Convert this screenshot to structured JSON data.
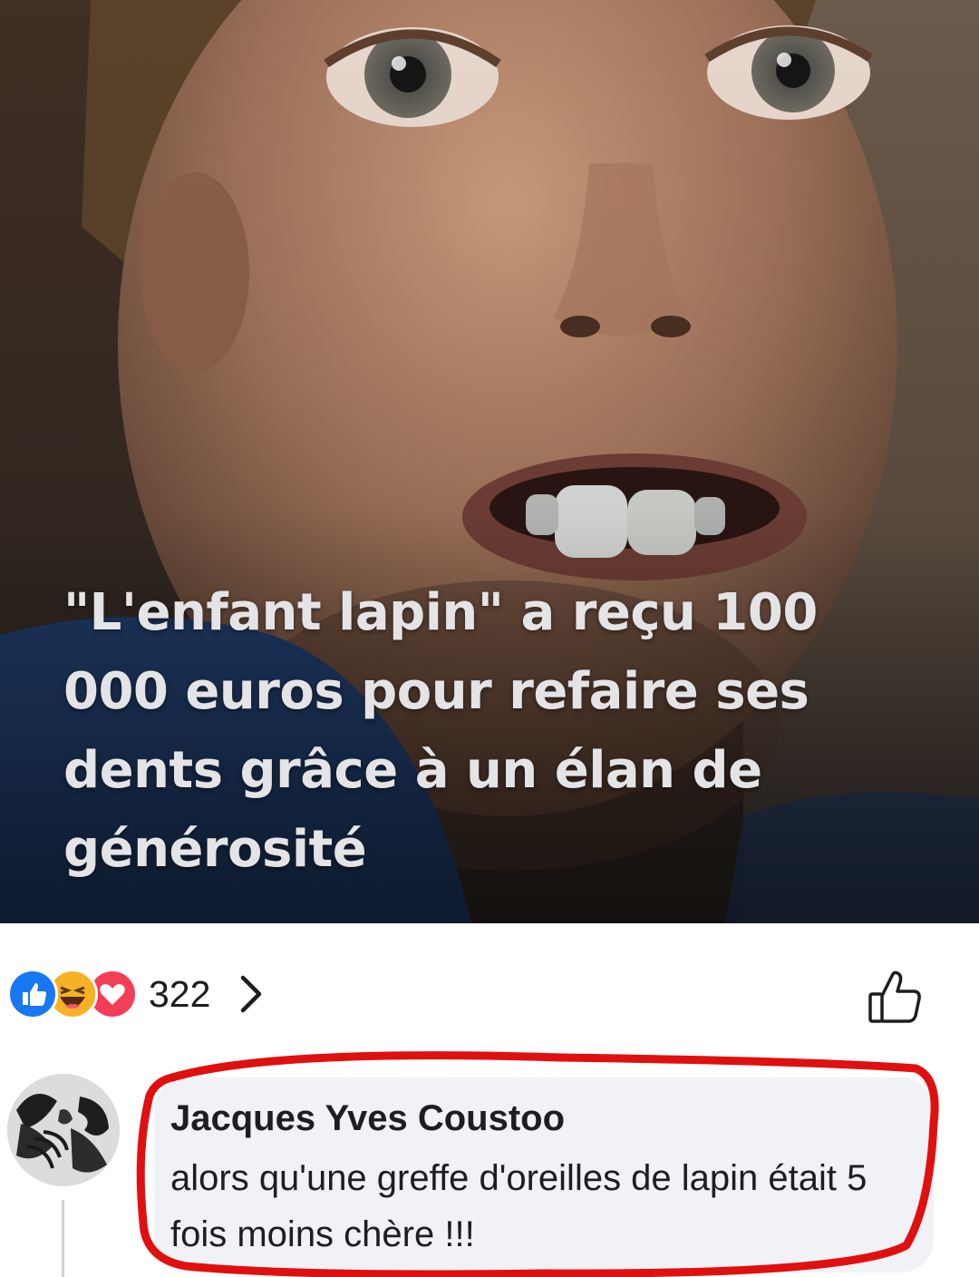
{
  "post": {
    "headline": "\"L'enfant lapin\" a reçu 100 000 euros pour refaire ses dents grâce à un élan de générosité"
  },
  "reactions": {
    "icons": [
      "like-icon",
      "haha-icon",
      "love-icon"
    ],
    "count": "322",
    "like_button_icon": "thumbs-up-outline-icon"
  },
  "comment": {
    "author": "Jacques Yves Coustoo",
    "text": "alors qu'une greffe d'oreilles de lapin était 5 fois moins chère !!!",
    "highlight_color": "#e01010"
  },
  "colors": {
    "like_blue": "#1877f2",
    "love_red": "#f33e58",
    "haha_yellow": "#f7b125",
    "bubble_gray": "#f0f2f5"
  }
}
